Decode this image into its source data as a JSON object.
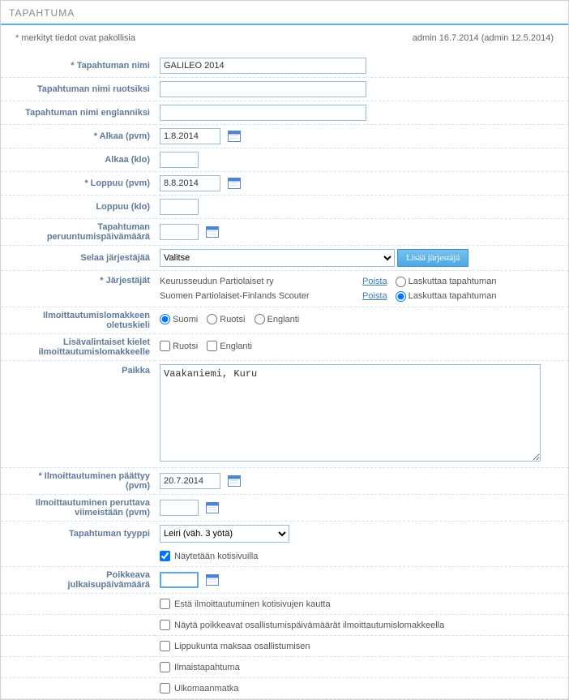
{
  "panel_title": "TAPAHTUMA",
  "required_note": "* merkityt tiedot ovat pakollisia",
  "audit": "admin 16.7.2014 (admin 12.5.2014)",
  "labels": {
    "name": "* Tapahtuman nimi",
    "name_sv": "Tapahtuman nimi ruotsiksi",
    "name_en": "Tapahtuman nimi englanniksi",
    "starts_date": "* Alkaa (pvm)",
    "starts_time": "Alkaa (klo)",
    "ends_date": "* Loppuu (pvm)",
    "ends_time": "Loppuu (klo)",
    "cancel_a": "Tapahtuman",
    "cancel_b": "peruuntumispäivämäärä",
    "browse_org": "Selaa järjestäjää",
    "orgs": "* Järjestäjät",
    "default_lang_a": "Ilmoittautumislomakkeen",
    "default_lang_b": "oletuskieli",
    "extra_lang_a": "Lisävalintaiset kielet",
    "extra_lang_b": "ilmoittautumislomakkeelle",
    "place": "Paikka",
    "reg_ends_a": "* Ilmoittautuminen päättyy",
    "reg_ends_b": "(pvm)",
    "reg_cancel_a": "Ilmoittautuminen peruttava",
    "reg_cancel_b": "viimeistään (pvm)",
    "type": "Tapahtuman tyyppi",
    "pub_a": "Poikkeava",
    "pub_b": "julkaisupäivämäärä"
  },
  "values": {
    "name": "GALILEO 2014",
    "name_sv": "",
    "name_en": "",
    "starts_date": "1.8.2014",
    "starts_time": "",
    "ends_date": "8.8.2014",
    "ends_time": "",
    "cancel_date": "",
    "place": "Vaakaniemi, Kuru",
    "reg_ends": "20.7.2014",
    "reg_cancel": "",
    "pub_date": ""
  },
  "organizer_select_placeholder": "Valitse",
  "add_organizer_btn": "Lisää järjestäjä",
  "organizers": [
    {
      "name": "Keurusseudun Partiolaiset ry",
      "del": "Poista",
      "invoices": "Laskuttaa tapahtuman"
    },
    {
      "name": "Suomen Partiolaiset-Finlands Scouter",
      "del": "Poista",
      "invoices": "Laskuttaa tapahtuman"
    }
  ],
  "lang_opts": {
    "fi": "Suomi",
    "sv": "Ruotsi",
    "en": "Englanti"
  },
  "type_selected": "Leiri (väh. 3 yötä)",
  "show_on_site": "Näytetään kotisivuilla",
  "flags": {
    "block_web": "Estä ilmoittautuminen kotisivujen kautta",
    "show_diff": "Näytä poikkeavat osallistumispäivämäärät ilmoittautumislomakkeella",
    "troop_pays": "Lippukunta maksaa osallistumisen",
    "free": "Ilmaistapahtuma",
    "abroad": "Ulkomaanmatka"
  }
}
